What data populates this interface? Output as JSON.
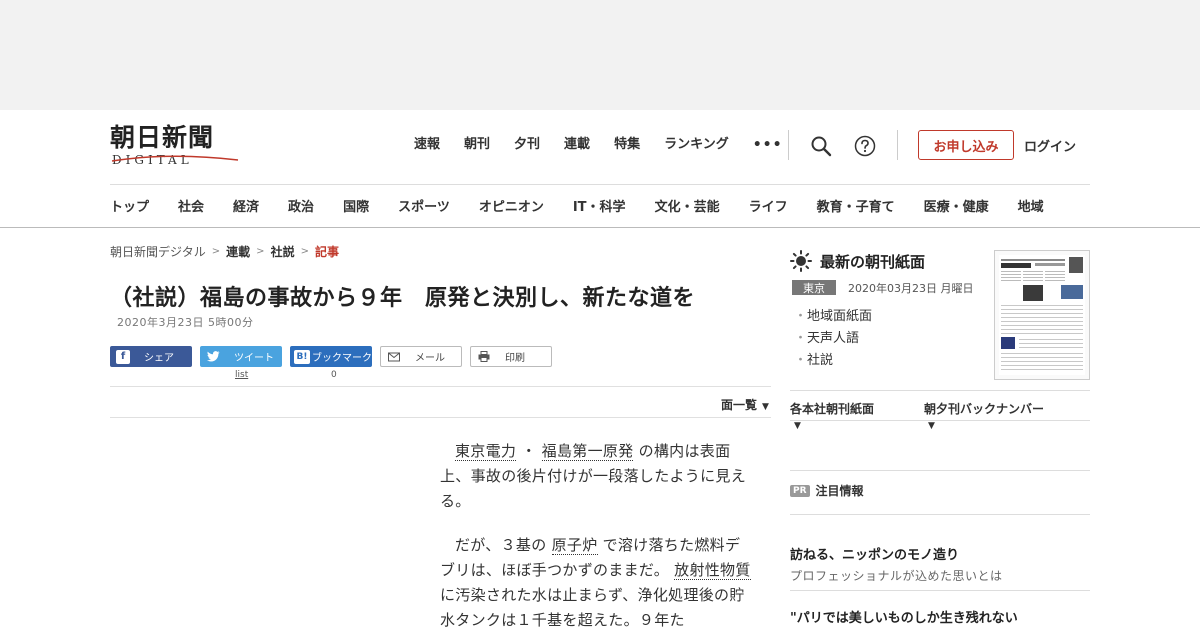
{
  "logo": {
    "title": "朝日新聞",
    "subtitle": "DIGITAL"
  },
  "topnav": {
    "items": [
      "速報",
      "朝刊",
      "夕刊",
      "連載",
      "特集",
      "ランキング"
    ],
    "more": "•••",
    "apply_label": "お申し込み",
    "login_label": "ログイン"
  },
  "catnav": {
    "items": [
      "トップ",
      "社会",
      "経済",
      "政治",
      "国際",
      "スポーツ",
      "オピニオン",
      "IT・科学",
      "文化・芸能",
      "ライフ",
      "教育・子育て",
      "医療・健康",
      "地域"
    ]
  },
  "breadcrumb": {
    "items": [
      "朝日新聞デジタル",
      "連載",
      "社説"
    ],
    "current": "記事",
    "separator": ">"
  },
  "article": {
    "title": "（社説）福島の事故から９年　原発と決別し、新たな道を",
    "date": "2020年3月23日 5時00分",
    "share": {
      "facebook": "シェア",
      "twitter": "ツイート",
      "hatena": "ブックマーク",
      "mail": "メール",
      "print": "印刷",
      "twitter_count": "list",
      "hatena_count": "0"
    },
    "menlist_label": "面一覧",
    "paragraphs": [
      {
        "link1": "東京電力",
        "sep": "・",
        "link2": "福島第一原発",
        "rest": "の構内は表面上、事故の後片付けが一段落したように見える。"
      },
      {
        "pre": "だが、３基の",
        "link1": "原子炉",
        "mid": "で溶け落ちた燃料デブリは、ほぼ手つかずのままだ。",
        "link2": "放射性物質",
        "rest": "に汚染された水は止まらず、浄化処理後の貯水タンクは１千基を超えた。９年た"
      }
    ]
  },
  "sidebar": {
    "title": "最新の朝刊紙面",
    "region": "東京",
    "date": "2020年03月23日 月曜日",
    "links": [
      "地域面紙面",
      "天声人語",
      "社説"
    ],
    "menu": [
      "各本社朝刊紙面",
      "朝夕刊バックナンバー"
    ],
    "pr_badge": "PR",
    "pr_label": "注目情報",
    "promos": [
      {
        "title": "訪ねる、ニッポンのモノ造り",
        "sub": "プロフェッショナルが込めた思いとは"
      },
      {
        "title": "\"パリでは美しいものしか生き残れない",
        "sub": ""
      }
    ]
  },
  "colors": {
    "accent_red": "#c0392b",
    "facebook": "#3b5998",
    "twitter": "#4aa3df",
    "hatena": "#2c6ebd"
  },
  "icons": [
    "search-icon",
    "help-icon",
    "sun-icon",
    "facebook-icon",
    "twitter-icon",
    "hatena-icon",
    "mail-icon",
    "print-icon"
  ]
}
